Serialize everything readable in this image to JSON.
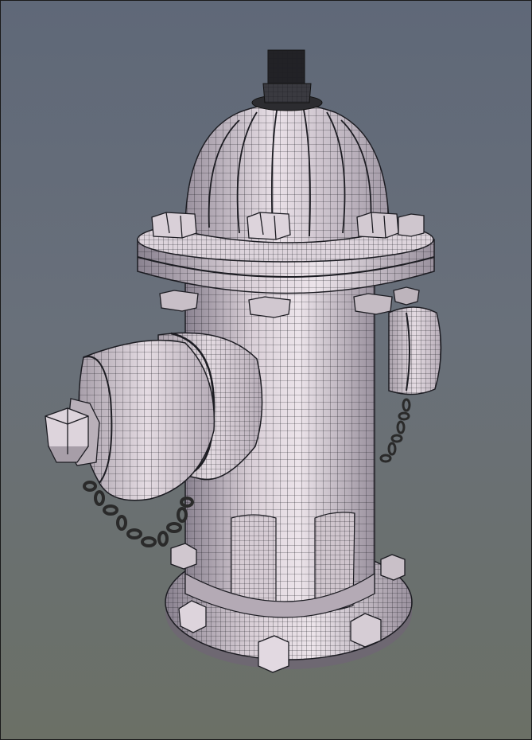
{
  "scene": {
    "subject": "fire-hydrant-wireframe-render",
    "colors": {
      "background_top": "#5f6878",
      "background_bottom": "#6b7066",
      "surface_light": "#e8dfe6",
      "surface_mid": "#c2b7c0",
      "surface_dark": "#8c8490",
      "wire": "#1c1c22",
      "chain": "#2a2a2a"
    }
  }
}
